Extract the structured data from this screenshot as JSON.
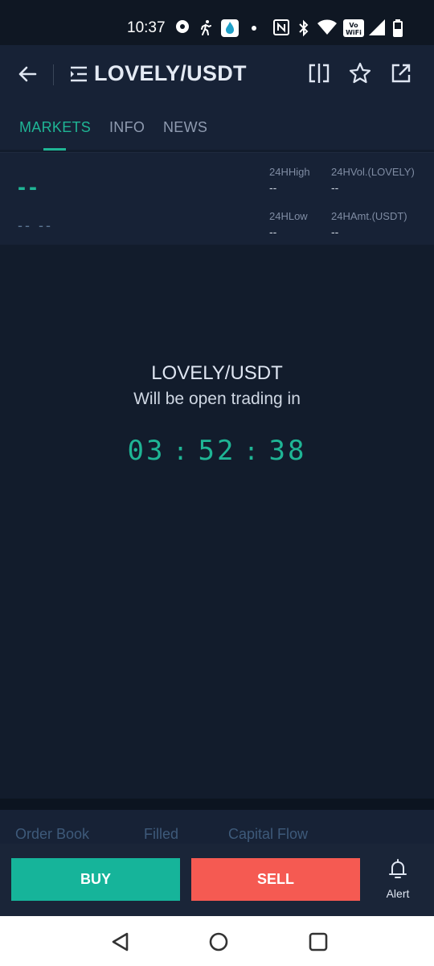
{
  "status_bar": {
    "time": "10:37",
    "icons": [
      "dot-app-icon",
      "runner-icon",
      "huobi-app-icon",
      "dot-icon",
      "nfc-icon",
      "bluetooth-icon",
      "wifi-icon",
      "vowifi-icon",
      "signal-icon",
      "battery-icon"
    ]
  },
  "header": {
    "title": "LOVELY/USDT",
    "icons": [
      "back-arrow-icon",
      "list-menu-icon",
      "compare-icon",
      "star-icon",
      "share-icon"
    ]
  },
  "tabs": [
    {
      "label": "MARKETS",
      "active": true
    },
    {
      "label": "INFO",
      "active": false
    },
    {
      "label": "NEWS",
      "active": false
    }
  ],
  "stats": {
    "price": "--",
    "change": "-- --",
    "high_label": "24HHigh",
    "high_value": "--",
    "vol_label": "24HVol.(LOVELY)",
    "vol_value": "--",
    "low_label": "24HLow",
    "low_value": "--",
    "amt_label": "24HAmt.(USDT)",
    "amt_value": "--"
  },
  "countdown": {
    "pair": "LOVELY/USDT",
    "message": "Will be open trading in",
    "hours": "03",
    "minutes": "52",
    "seconds": "38",
    "separator": ":"
  },
  "subtabs": [
    "Order Book",
    "Filled",
    "Capital Flow"
  ],
  "actions": {
    "buy_label": "BUY",
    "sell_label": "SELL",
    "alert_label": "Alert"
  },
  "colors": {
    "accent": "#1fb595",
    "buy": "#16b49a",
    "sell": "#f55a52",
    "background": "#121c2c"
  }
}
